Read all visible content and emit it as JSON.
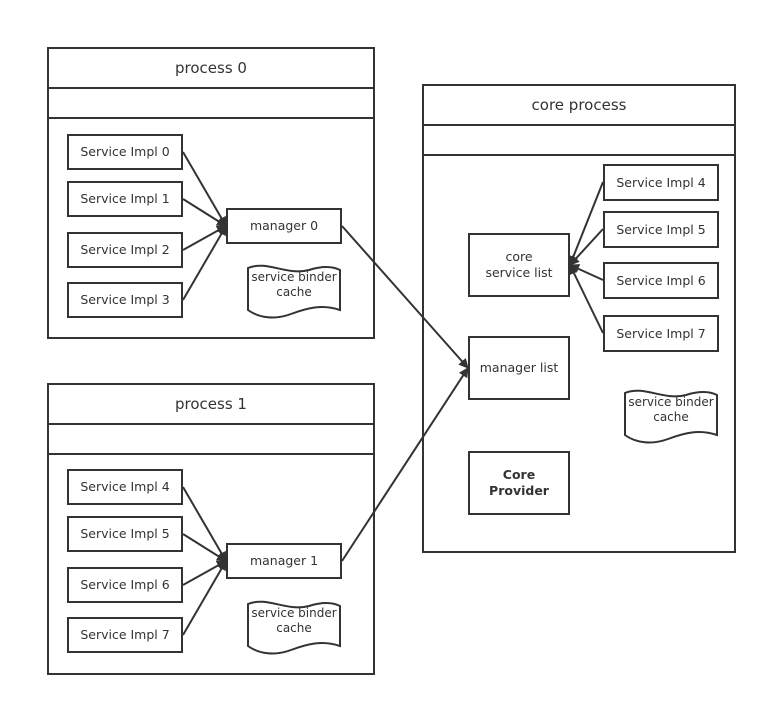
{
  "diagram": {
    "process0": {
      "title": "process 0",
      "services": [
        "Service Impl 0",
        "Service Impl 1",
        "Service Impl 2",
        "Service Impl 3"
      ],
      "manager": "manager 0",
      "cache": "service binder cache"
    },
    "process1": {
      "title": "process 1",
      "services": [
        "Service Impl 4",
        "Service Impl 5",
        "Service Impl 6",
        "Service Impl 7"
      ],
      "manager": "manager 1",
      "cache": "service binder cache"
    },
    "core": {
      "title": "core process",
      "service_list": "core service list",
      "services": [
        "Service Impl 4",
        "Service Impl 5",
        "Service Impl 6",
        "Service Impl 7"
      ],
      "manager_list": "manager list",
      "cache": "service binder cache",
      "provider": "Core Provider"
    },
    "edges": [
      {
        "from": "process0.services.0",
        "to": "process0.manager"
      },
      {
        "from": "process0.services.1",
        "to": "process0.manager"
      },
      {
        "from": "process0.services.2",
        "to": "process0.manager"
      },
      {
        "from": "process0.services.3",
        "to": "process0.manager"
      },
      {
        "from": "process1.services.0",
        "to": "process1.manager"
      },
      {
        "from": "process1.services.1",
        "to": "process1.manager"
      },
      {
        "from": "process1.services.2",
        "to": "process1.manager"
      },
      {
        "from": "process1.services.3",
        "to": "process1.manager"
      },
      {
        "from": "core.services.0",
        "to": "core.service_list"
      },
      {
        "from": "core.services.1",
        "to": "core.service_list"
      },
      {
        "from": "core.services.2",
        "to": "core.service_list"
      },
      {
        "from": "core.services.3",
        "to": "core.service_list"
      },
      {
        "from": "process0.manager",
        "to": "core.manager_list"
      },
      {
        "from": "process1.manager",
        "to": "core.manager_list"
      }
    ]
  }
}
